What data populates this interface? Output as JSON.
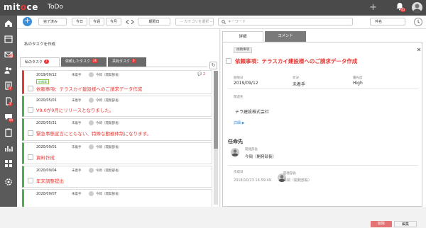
{
  "header": {
    "brand_pre": "mit",
    "brand_o": "o",
    "brand_post": "ce",
    "app_title": "ToDo",
    "plus_label": "+",
    "notif_count": "43"
  },
  "sidebar": {
    "badges": [
      "17",
      "1",
      "3",
      "99"
    ]
  },
  "toolbar": {
    "add_label": "+",
    "filter_select": "完了済み",
    "today": "今日",
    "this_week": "今週",
    "this_month": "今月",
    "period_label": "期限日",
    "category_placeholder": "-- カテゴリを選択 --",
    "keyword_placeholder": "キーワード",
    "sort_select": "件名"
  },
  "left": {
    "title": "私のタスクを作成",
    "tabs": [
      {
        "label": "私のタスク",
        "count": "7"
      },
      {
        "label": "依頼したタスク",
        "count": "26"
      },
      {
        "label": "共有タスク",
        "count": "0"
      }
    ],
    "refresh_icon": "↻",
    "cards": [
      {
        "date": "2019/09/12",
        "status": "未着手",
        "assignee": "今岡（開発部長）",
        "chip": "依頼事",
        "title": "依頼事項：テラスカイ建設様へのご請求データ作成",
        "comments": "2"
      },
      {
        "date": "2020/05/01",
        "status": "未着手",
        "assignee": "今岡（開発部長）",
        "title": "V9.0が9月にリリースとなりました。"
      },
      {
        "date": "2020/05/31",
        "status": "未着手",
        "assignee": "今岡（開発部長）",
        "title": "緊急事態宣言にともない、特殊な勤務体制になります。"
      },
      {
        "date": "2020/09/01",
        "status": "未着手",
        "assignee": "今岡（開発部長）",
        "title": "資料作成"
      },
      {
        "date": "2020/09/04",
        "status": "未着手",
        "assignee": "今岡（開発部長）",
        "title": "年末調整提出"
      },
      {
        "date": "2020/09/07",
        "status": "未着手",
        "assignee": "今岡（開発部長）",
        "title": ""
      }
    ]
  },
  "right": {
    "tabs": [
      "詳細",
      "コメント"
    ],
    "chip": "依頼事項",
    "title": "依頼事項：テラスカイ建設様へのご請求データ作成",
    "fields": [
      {
        "label": "期限日",
        "value": "2019/09/12"
      },
      {
        "label": "状況",
        "value": "未着手"
      },
      {
        "label": "優先度",
        "value": "High"
      }
    ],
    "related_label": "関連先",
    "related_value": "テラ建設株式会社",
    "details_link": "詳細 ▶",
    "assignee_section": "任命先",
    "assignee_dept": "開発部長",
    "assignee_name": "今岡（開発部長）",
    "created_label": "作成日",
    "created_value": "2018/10/23 16:59:49",
    "creator_dept": "開発部長",
    "creator_name": "今岡（開発部長）",
    "delete_btn": "削除",
    "edit_btn": "編集"
  }
}
